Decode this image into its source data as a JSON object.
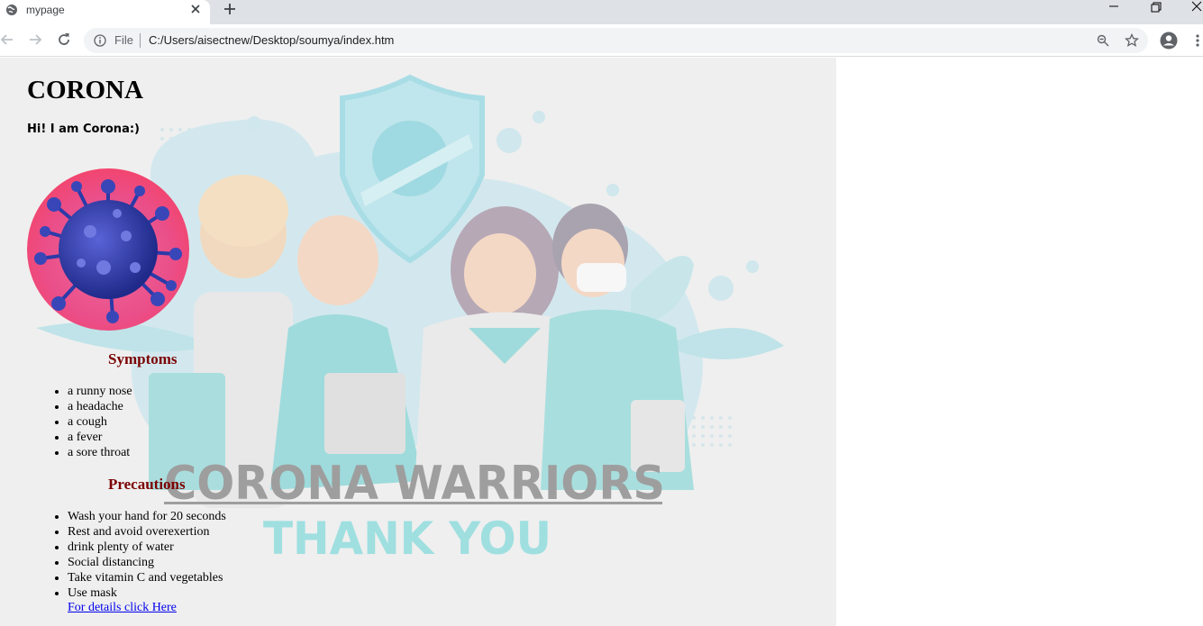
{
  "browser": {
    "tab_title": "mypage",
    "omnibox_scheme": "File",
    "url": "C:/Users/aisectnew/Desktop/soumya/index.htm"
  },
  "page": {
    "title": "CORONA",
    "intro": "Hi! I am Corona:)",
    "symptoms_heading": "Symptoms",
    "symptoms": [
      "a runny nose",
      "a headache",
      "a cough",
      "a fever",
      "a sore throat"
    ],
    "precautions_heading": "Precautions",
    "precautions": [
      "Wash your hand for 20 seconds",
      "Rest and avoid overexertion",
      "drink plenty of water",
      "Social distancing",
      "Take vitamin C and vegetables",
      "Use mask"
    ],
    "details_link": "For details click Here",
    "banner_line1": "CORONA WARRIORS",
    "banner_line2": "THANK YOU"
  },
  "colors": {
    "heading_red": "#7b0000",
    "link_blue": "#0000ee",
    "page_bg": "#efefef",
    "banner_gray": "#9e9e9e",
    "banner_teal": "#9fdfe0"
  }
}
